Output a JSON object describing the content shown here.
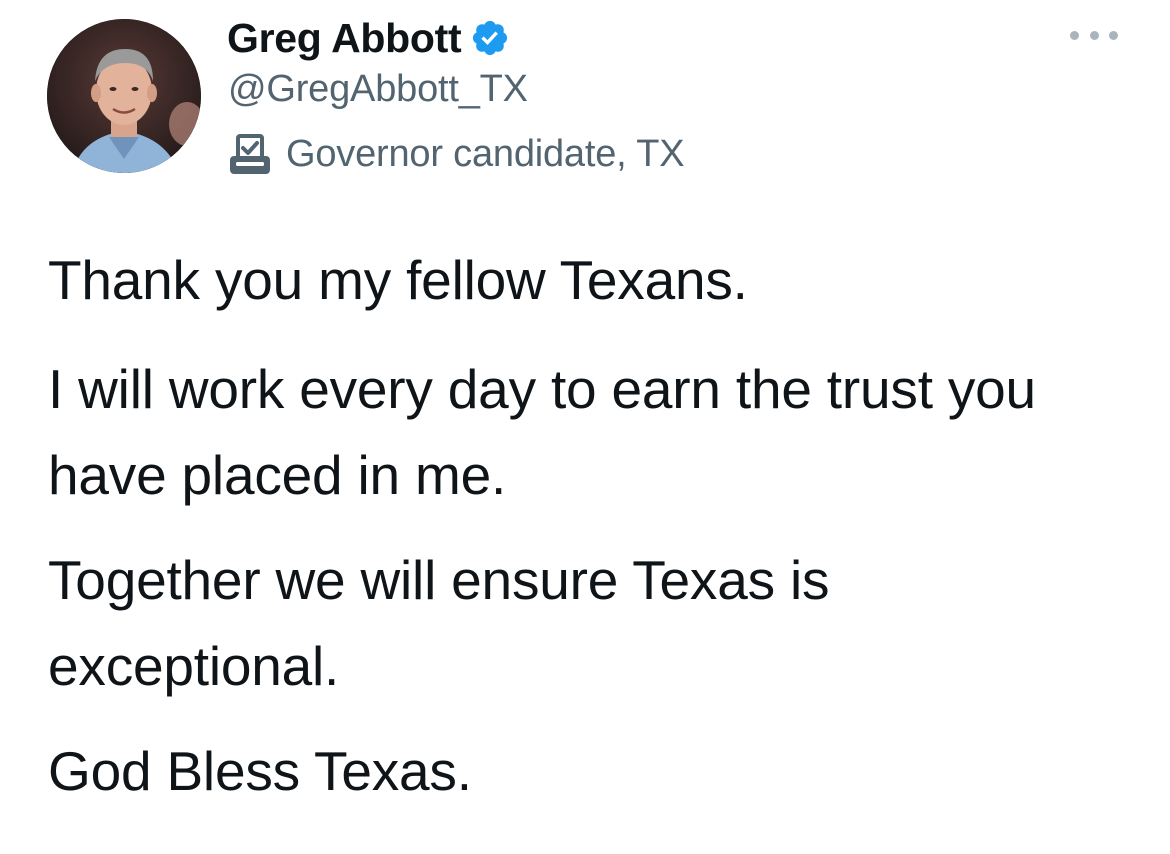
{
  "tweet": {
    "display_name": "Greg Abbott",
    "handle": "@GregAbbott_TX",
    "label": "Governor candidate, TX",
    "label_icon": "ballot-box-icon",
    "verified_icon": "verified-badge-icon",
    "more_icon": "more-options-icon",
    "paragraphs": [
      "Thank you my fellow Texans.",
      "I will work every day to earn the trust you have placed in me.",
      "Together we will ensure Texas is exceptional.",
      "God Bless Texas."
    ]
  },
  "colors": {
    "verified_blue": "#1d9bf0",
    "secondary_text": "#536471",
    "primary_text": "#0f1419",
    "dots": "#aab4bc"
  }
}
